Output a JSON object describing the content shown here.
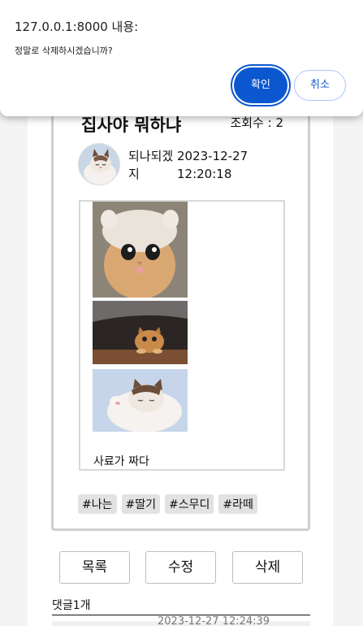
{
  "dialog": {
    "title": "127.0.0.1:8000 내용:",
    "message": "정말로 삭제하시겠습니까?",
    "ok_label": "확인",
    "cancel_label": "취소",
    "accent_color": "#0b57d0"
  },
  "post": {
    "title": "집사야 뭐하냐",
    "view_count": "조회수 : 2",
    "author": "되나되겠지",
    "date": "2023-12-27 12:20:18",
    "content_text": "사료가 짜다",
    "tags": [
      "#나는",
      "#딸기",
      "#스무디",
      "#라떼"
    ]
  },
  "actions": {
    "list_label": "목록",
    "edit_label": "수정",
    "delete_label": "삭제"
  },
  "comments": {
    "header": "댓글1개",
    "first_preview": "2023-12-27 12:24:39"
  }
}
